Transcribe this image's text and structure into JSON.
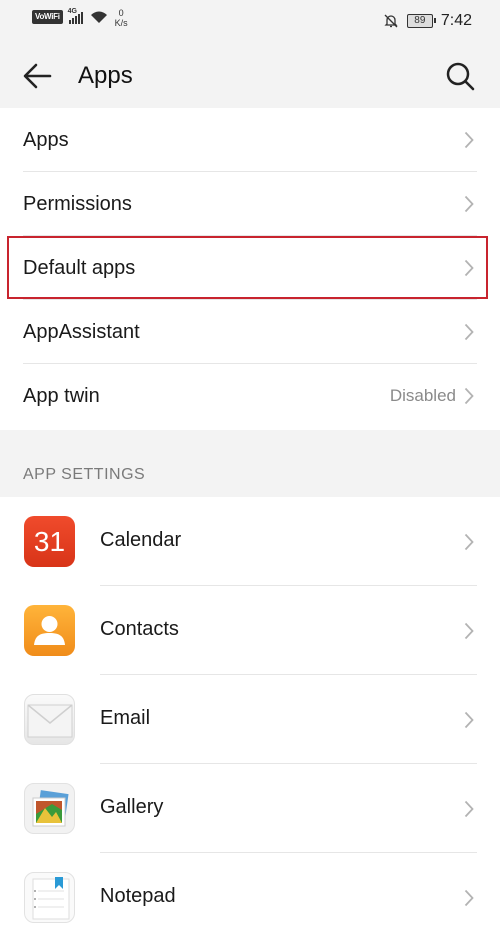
{
  "status_bar": {
    "wifi_label": "VoWiFi",
    "network_type": "4G",
    "net_speed_value": "0",
    "net_speed_unit": "K/s",
    "battery": "89",
    "time": "7:42"
  },
  "app_bar": {
    "title": "Apps",
    "back_icon": "back-arrow-icon",
    "search_icon": "search-icon"
  },
  "menu": {
    "items": [
      {
        "label": "Apps"
      },
      {
        "label": "Permissions"
      },
      {
        "label": "Default apps"
      },
      {
        "label": "AppAssistant"
      },
      {
        "label": "App twin",
        "value": "Disabled"
      }
    ]
  },
  "app_settings": {
    "header": "APP SETTINGS",
    "apps": [
      {
        "label": "Calendar",
        "icon": "calendar-icon",
        "icon_text": "31"
      },
      {
        "label": "Contacts",
        "icon": "contacts-icon"
      },
      {
        "label": "Email",
        "icon": "email-icon"
      },
      {
        "label": "Gallery",
        "icon": "gallery-icon"
      },
      {
        "label": "Notepad",
        "icon": "notepad-icon"
      }
    ]
  },
  "colors": {
    "highlight": "#c8242e",
    "background": "#f3f3f3",
    "calendar": "#e5401f",
    "contacts": "#f5a02a"
  }
}
